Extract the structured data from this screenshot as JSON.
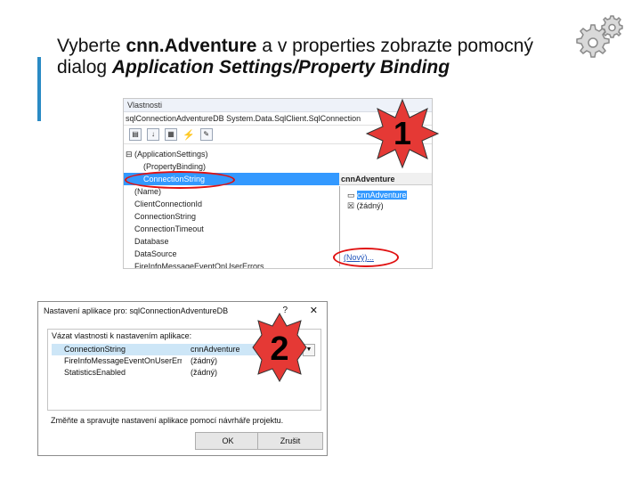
{
  "slide": {
    "title_part1": "Vyberte ",
    "title_bold": "cnn.Adventure",
    "title_part2": " a v properties zobrazte pomocný dialog ",
    "title_italic": "Application Settings/Property Binding"
  },
  "properties_panel": {
    "header": "Vlastnosti",
    "object": "sqlConnectionAdventureDB  System.Data.SqlClient.SqlConnection",
    "toolbar_icons": [
      "categorized-icon",
      "alphabetical-icon",
      "properties-icon",
      "events-icon",
      "property-pages-icon"
    ],
    "rows": [
      {
        "label": "(ApplicationSettings)",
        "expanded": true
      },
      {
        "label": "(PropertyBinding)"
      },
      {
        "label": "ConnectionString",
        "selected": true
      },
      {
        "label": "(Name)"
      },
      {
        "label": "ClientConnectionId"
      },
      {
        "label": "ConnectionString"
      },
      {
        "label": "ConnectionTimeout"
      },
      {
        "label": "Database"
      },
      {
        "label": "DataSource"
      },
      {
        "label": "FireInfoMessageEventOnUserErrors"
      }
    ],
    "binding_value": "cnnAdventure",
    "dropdown_items": [
      "cnnAdventure",
      "(žádný)"
    ],
    "dropdown_new": "(Nový)..."
  },
  "dialog": {
    "title": "Nastavení aplikace pro: sqlConnectionAdventureDB",
    "help": "?",
    "close": "✕",
    "group_label": "Vázat vlastnosti k nastavením aplikace:",
    "rows": [
      {
        "name": "ConnectionString",
        "value": "cnnAdventure",
        "selected": true
      },
      {
        "name": "FireInfoMessageEventOnUserErr",
        "value": "(žádný)"
      },
      {
        "name": "StatisticsEnabled",
        "value": "(žádný)"
      }
    ],
    "hint": "Změňte a spravujte nastavení aplikace pomocí návrháře projektu.",
    "ok_label": "OK",
    "cancel_label": "Zrušit"
  },
  "badges": {
    "one": "1",
    "two": "2"
  },
  "colors": {
    "accent": "#2a8ac4",
    "selection": "#3399ff",
    "callout": "#e01010",
    "badge": "#e53935"
  }
}
